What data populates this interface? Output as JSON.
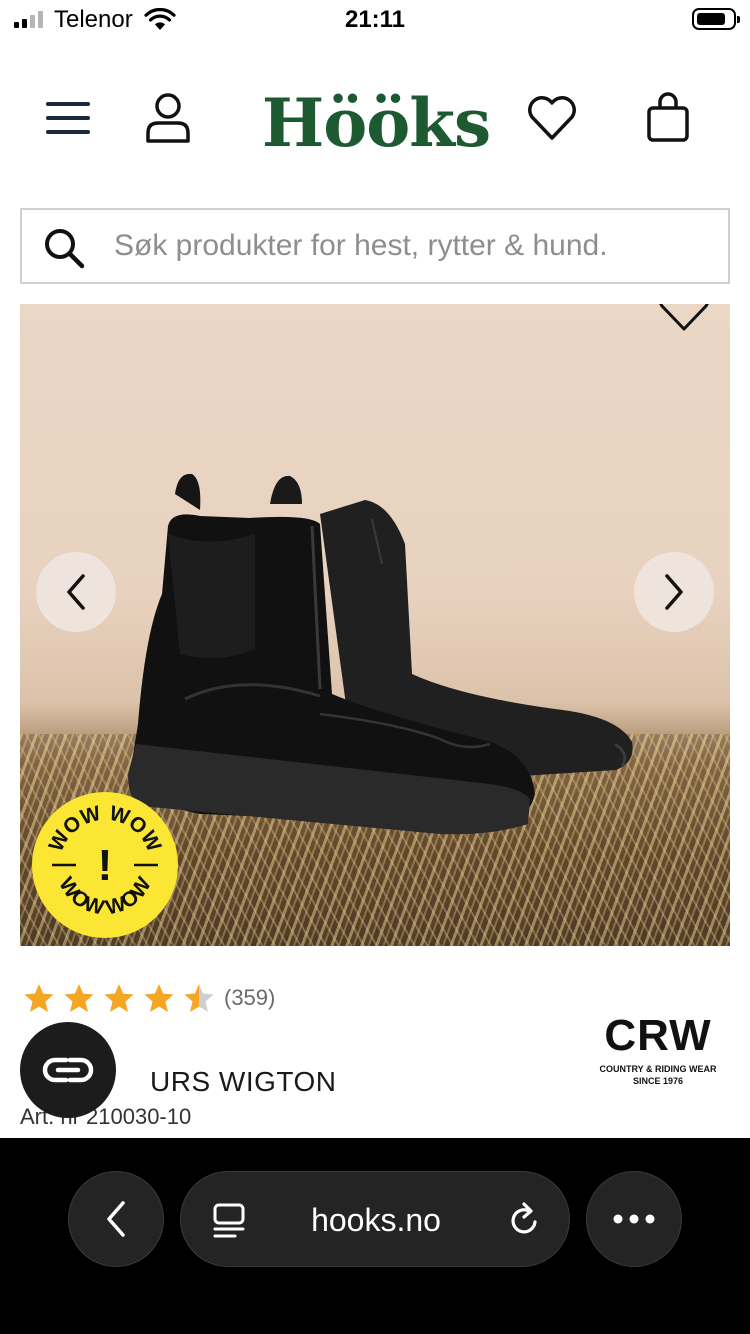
{
  "status_bar": {
    "carrier": "Telenor",
    "time": "21:11",
    "icons": [
      "signal-icon",
      "wifi-icon",
      "battery-icon"
    ]
  },
  "header": {
    "logo": "Hööks",
    "icons": [
      "menu-icon",
      "account-icon",
      "wishlist-icon",
      "cart-icon"
    ],
    "brand_color": "#1d5a32"
  },
  "search": {
    "placeholder": "Søk produkter for hest, rytter & hund.",
    "value": ""
  },
  "gallery": {
    "badge_top": "WOW WOW",
    "badge_mark": "!",
    "badge_bottom": "WOW WOW",
    "badge_color": "#fbe733",
    "icons": [
      "chevron-left-icon",
      "chevron-right-icon",
      "heart-outline-icon"
    ]
  },
  "product": {
    "rating": 4.5,
    "rating_max": 5,
    "review_count": "(359)",
    "title": "URS WIGTON",
    "article_number": "Art. nr 210030-10",
    "brand": {
      "name": "CRW",
      "line1": "COUNTRY & RIDING WEAR",
      "line2": "SINCE 1976"
    },
    "star_color": "#f5a623"
  },
  "browser": {
    "url": "hooks.no",
    "icons": [
      "back-icon",
      "reader-icon",
      "reload-icon",
      "more-icon"
    ]
  }
}
